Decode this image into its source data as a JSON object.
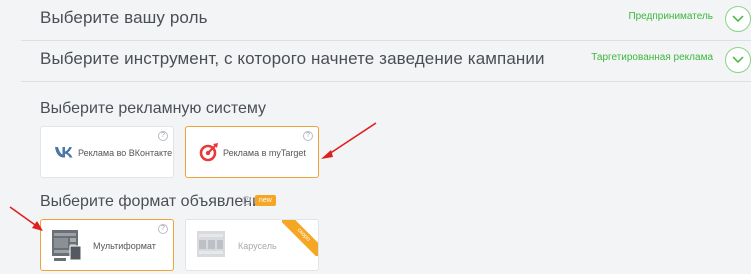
{
  "role": {
    "title": "Выберите вашу роль",
    "value": "Предприниматель"
  },
  "tool": {
    "title": "Выберите инструмент, с которого начнете заведение кампании",
    "value": "Таргетированная реклама"
  },
  "ad_system": {
    "title": "Выберите рекламную систему",
    "options": [
      {
        "label": "Реклама во ВКонтакте"
      },
      {
        "label": "Реклама в myTarget"
      }
    ]
  },
  "ad_format": {
    "title": "Выберите формат объявления",
    "badge": "new",
    "options": [
      {
        "label": "Мультиформат"
      },
      {
        "label": "Карусель",
        "ribbon": "скоро"
      }
    ]
  },
  "help_glyph": "?",
  "colors": {
    "accent_green": "#3db73d",
    "selected_border": "#f0a23a",
    "badge": "#f5a623",
    "arrow": "#e0201f",
    "vk_blue": "#4a76a8",
    "mytarget_red": "#e8393b"
  }
}
